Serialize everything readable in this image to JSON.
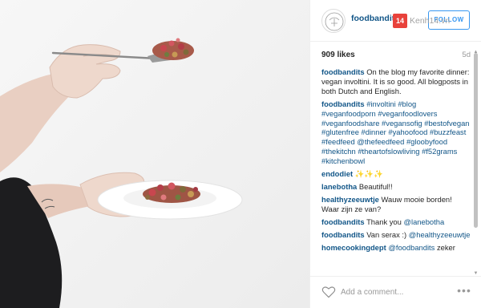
{
  "post": {
    "author": "foodbandits",
    "follow_label": "FOLLOW",
    "likes": "909 likes",
    "age": "5d"
  },
  "watermark": {
    "badge": "14",
    "text": "Kenh14.vn"
  },
  "comments": [
    {
      "user": "foodbandits",
      "text": "On the blog my favorite dinner: vegan involtini. It is so good. All blogposts in both Dutch and English."
    },
    {
      "user": "foodbandits",
      "tags": "#involtini #blog #veganfoodporn #veganfoodlovers #veganfoodshare #vegansofig #bestofvegan #glutenfree #dinner #yahoofood #buzzfeast #feedfeed @thefeedfeed #gloobyfood #thekitchn #theartofslowliving #f52grams #kitchenbowl"
    },
    {
      "user": "endodiet",
      "text": "✨✨✨"
    },
    {
      "user": "lanebotha",
      "text": "Beautiful!!"
    },
    {
      "user": "healthyzeeuwtje",
      "text": "Wauw mooie borden! Waar zijn ze van?"
    },
    {
      "user": "foodbandits",
      "text": "Thank you",
      "mention": "@lanebotha"
    },
    {
      "user": "foodbandits",
      "text": "Van serax :)",
      "mention": "@healthyzeeuwtje"
    },
    {
      "user": "homecookingdept",
      "mention": "@foodbandits",
      "text": "zeker"
    }
  ],
  "footer": {
    "comment_placeholder": "Add a comment...",
    "more_label": "•••"
  },
  "icons": {
    "heart": "heart-icon",
    "more": "more-options-icon",
    "avatar": "foodbandits-logo"
  },
  "colors": {
    "username": "#125688",
    "follow": "#3897f0",
    "photo_background": "#f4f4f4"
  }
}
